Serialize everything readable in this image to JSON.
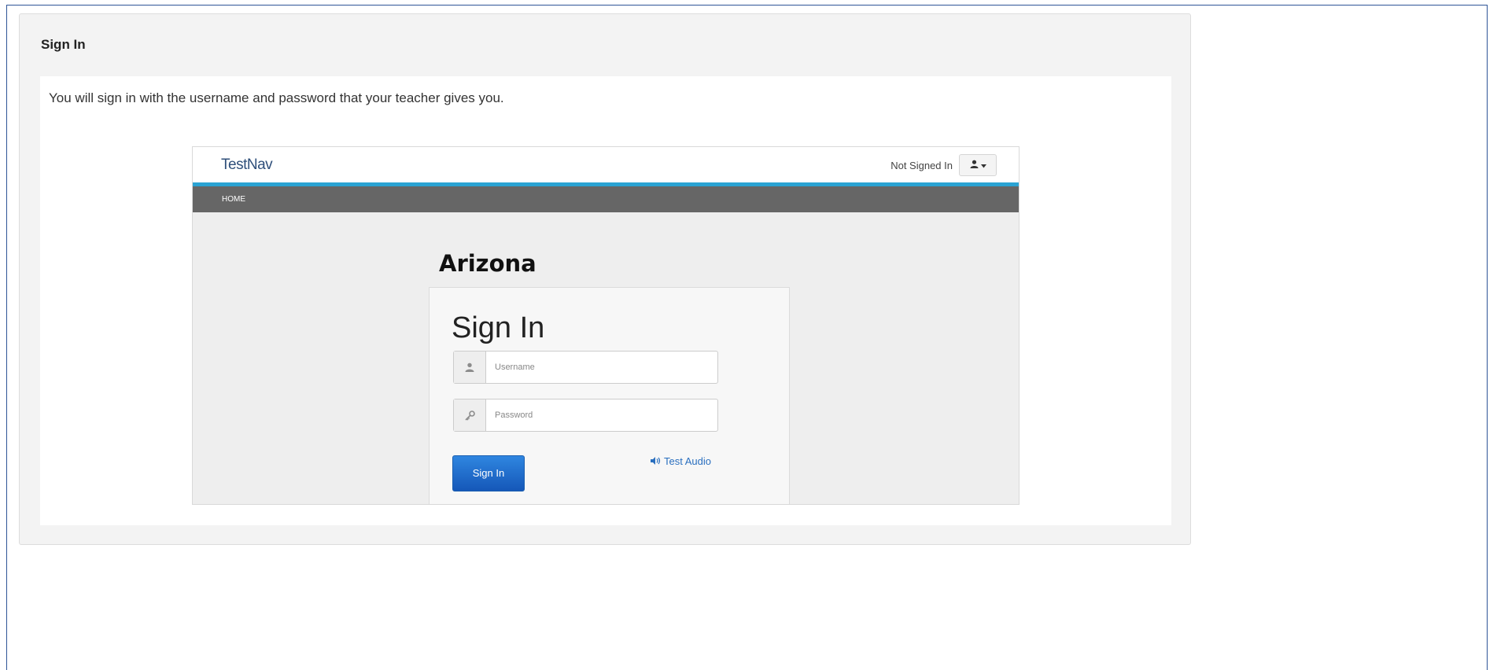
{
  "panel": {
    "heading": "Sign In",
    "intro": "You will sign in with the username and password that your teacher gives you."
  },
  "screenshot": {
    "brand": "TestNav",
    "status": "Not Signed In",
    "nav": {
      "home": "HOME"
    },
    "state": "Arizona",
    "login": {
      "title": "Sign In",
      "username_placeholder": "Username",
      "password_placeholder": "Password",
      "submit_label": "Sign In",
      "audio_label": "Test Audio"
    },
    "colors": {
      "accent_bar": "#2aa3d3",
      "nav_bar": "#666666",
      "primary_button": "#1f6ccb",
      "link": "#2a6fbf"
    },
    "icons": [
      "user-icon",
      "caret-down-icon",
      "key-icon",
      "speaker-icon"
    ]
  }
}
